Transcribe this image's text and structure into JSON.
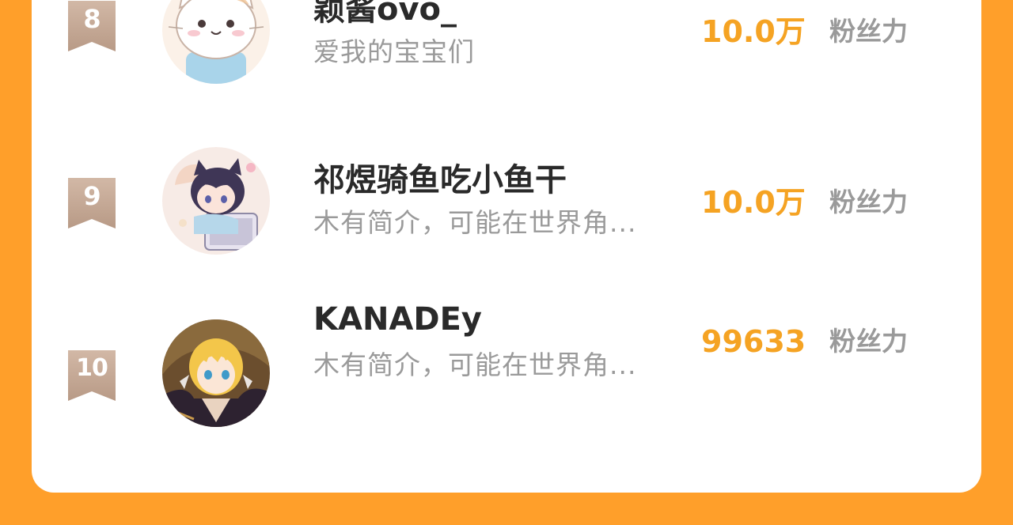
{
  "ranking": {
    "entries": [
      {
        "rank": "8",
        "name": "颖酱ovo_",
        "bio": "爱我的宝宝们",
        "fans_value": "10.0万",
        "fans_unit": "粉丝力",
        "avatar_icon": "cat-avatar-icon"
      },
      {
        "rank": "9",
        "name": "祁煜骑鱼吃小鱼干",
        "bio": "木有简介，可能在世界角...",
        "fans_value": "10.0万",
        "fans_unit": "粉丝力",
        "avatar_icon": "anime-boy-avatar-icon"
      },
      {
        "rank": "10",
        "name": "KANADEy",
        "bio": "木有简介，可能在世界角...",
        "fans_value": "99633",
        "fans_unit": "粉丝力",
        "avatar_icon": "blond-anime-avatar-icon"
      }
    ]
  },
  "colors": {
    "background": "#ff9f2a",
    "card": "#ffffff",
    "fans_accent": "#f5a323",
    "rank_ribbon": "#c4a592",
    "name_text": "#2a2a2a",
    "muted_text": "#9a9a9a"
  }
}
